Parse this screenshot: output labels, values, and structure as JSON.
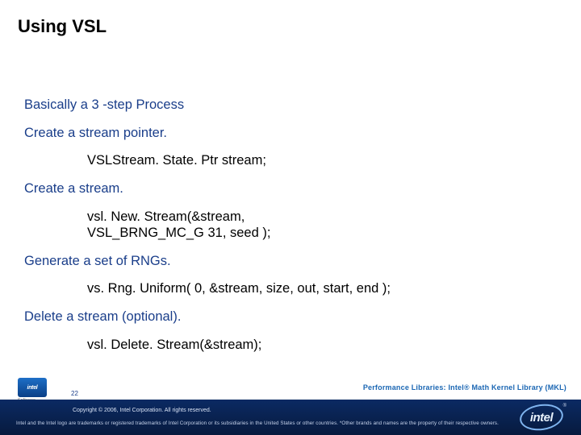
{
  "title": "Using VSL",
  "lines": {
    "intro": "Basically a 3 -step Process",
    "step1": "Create a stream pointer.",
    "code1": "VSLStream. State. Ptr stream;",
    "step2": "Create a stream.",
    "code2a": "vsl. New. Stream(&stream,",
    "code2b": "VSL_BRNG_MC_G 31, seed );",
    "step3": "Generate a set of RNGs.",
    "code3": "vs. Rng. Uniform( 0, &stream, size, out, start, end );",
    "step4": "Delete a stream (optional).",
    "code4": "vsl. Delete. Stream(&stream);"
  },
  "perf_label": "Performance Libraries: Intel® Math Kernel Library (MKL)",
  "page_number": "22",
  "badge_text": "intel",
  "badge_sub": "Software",
  "copyright": "Copyright © 2006, Intel Corporation. All rights reserved.",
  "disclaimer": "Intel and the Intel logo are trademarks or registered trademarks of Intel Corporation or its subsidiaries in the United States or other countries. *Other brands and names are the property of their respective owners.",
  "logo_text": "intel",
  "logo_reg": "®"
}
